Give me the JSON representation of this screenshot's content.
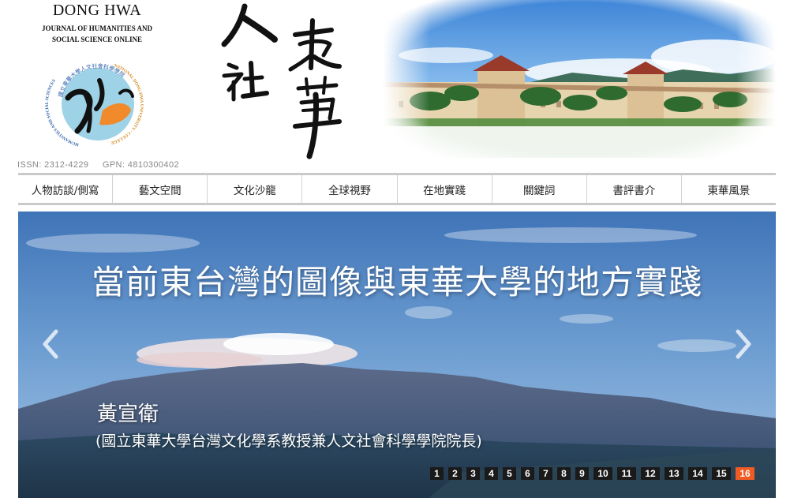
{
  "brand": {
    "title": "DONG HWA",
    "subtitle_line1": "JOURNAL OF HUMANITIES AND",
    "subtitle_line2": "SOCIAL SCIENCE ONLINE",
    "seal_text_top": "國立東華大學人文社會科學學院",
    "seal_text_right": "NATIONAL DONG HWA UNIVERSITY · COLLEGE OF",
    "seal_text_left": "HUMANITIES AND SOCIAL SCIENCES"
  },
  "calligraphy": {
    "chars_left": [
      "人",
      "社"
    ],
    "chars_right": [
      "東",
      "華"
    ]
  },
  "identifiers": {
    "issn": "ISSN: 2312-4229",
    "gpn": "GPN: 4810300402"
  },
  "nav": {
    "items": [
      "人物訪談/側寫",
      "藝文空間",
      "文化沙龍",
      "全球視野",
      "在地實踐",
      "關鍵詞",
      "書評書介",
      "東華風景"
    ]
  },
  "slide": {
    "title": "當前東台灣的圖像與東華大學的地方實踐",
    "author": "黃宣衛",
    "affiliation": "(國立東華大學台灣文化學系教授兼人文社會科學學院院長)"
  },
  "pager": {
    "pages": [
      "1",
      "2",
      "3",
      "4",
      "5",
      "6",
      "7",
      "8",
      "9",
      "10",
      "11",
      "12",
      "13",
      "14",
      "15",
      "16"
    ],
    "active": "16",
    "active_color": "#f05a23"
  },
  "icons": {
    "prev": "chevron-left-icon",
    "next": "chevron-right-icon"
  }
}
